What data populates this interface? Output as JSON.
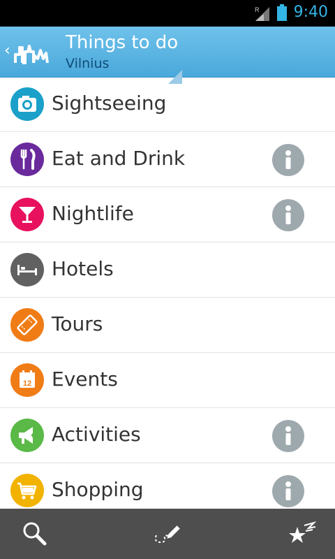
{
  "status_bar": {
    "time": "9:40",
    "signal_icon": "signal-roaming-icon",
    "battery_icon": "battery-icon"
  },
  "action_bar": {
    "title": "Things to do",
    "subtitle": "Vilnius",
    "logo_icon": "city-skyline-logo-icon"
  },
  "categories": [
    {
      "label": "Sightseeing",
      "icon": "camera-icon",
      "color": "#1aa0c9",
      "info": false
    },
    {
      "label": "Eat and Drink",
      "icon": "fork-knife-icon",
      "color": "#6a2a9c",
      "info": true
    },
    {
      "label": "Nightlife",
      "icon": "cocktail-icon",
      "color": "#e8115e",
      "info": true
    },
    {
      "label": "Hotels",
      "icon": "bed-icon",
      "color": "#616161",
      "info": false
    },
    {
      "label": "Tours",
      "icon": "ticket-icon",
      "color": "#f07c16",
      "info": false
    },
    {
      "label": "Events",
      "icon": "calendar-icon",
      "color": "#f07c16",
      "info": false,
      "calendar_day": "12"
    },
    {
      "label": "Activities",
      "icon": "megaphone-icon",
      "color": "#5ab947",
      "info": true
    },
    {
      "label": "Shopping",
      "icon": "shopping-cart-icon",
      "color": "#f2b300",
      "info": true
    }
  ],
  "bottom_bar": {
    "buttons": [
      "search-icon",
      "route-pencil-icon",
      "favorites-stars-icon"
    ]
  }
}
